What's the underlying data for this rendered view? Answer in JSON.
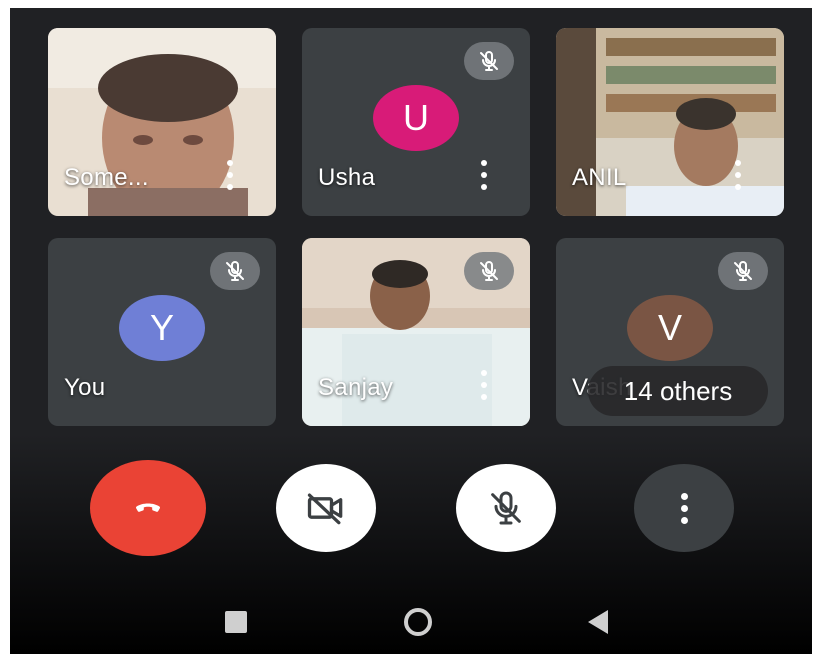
{
  "participants": [
    {
      "name": "Some...",
      "has_video": true,
      "muted": false
    },
    {
      "name": "Usha",
      "initial": "U",
      "avatar_color": "#d81b78",
      "muted": true
    },
    {
      "name": "ANIL",
      "has_video": true,
      "muted": false
    },
    {
      "name": "You",
      "initial": "Y",
      "avatar_color": "#6f7fd6",
      "muted": true
    },
    {
      "name": "Sanjay",
      "has_video": true,
      "muted": true
    },
    {
      "name": "Vaish",
      "initial": "V",
      "avatar_color": "#7a5544",
      "muted": true
    }
  ],
  "overflow_label": "14 others",
  "controls": {
    "hangup_color": "#ea4335",
    "camera_state": "off",
    "mic_state": "muted"
  },
  "icons": {
    "hangup": "phone-hangup-icon",
    "camera": "videocam-off-icon",
    "mic": "mic-off-icon",
    "more": "more-vert-icon"
  }
}
